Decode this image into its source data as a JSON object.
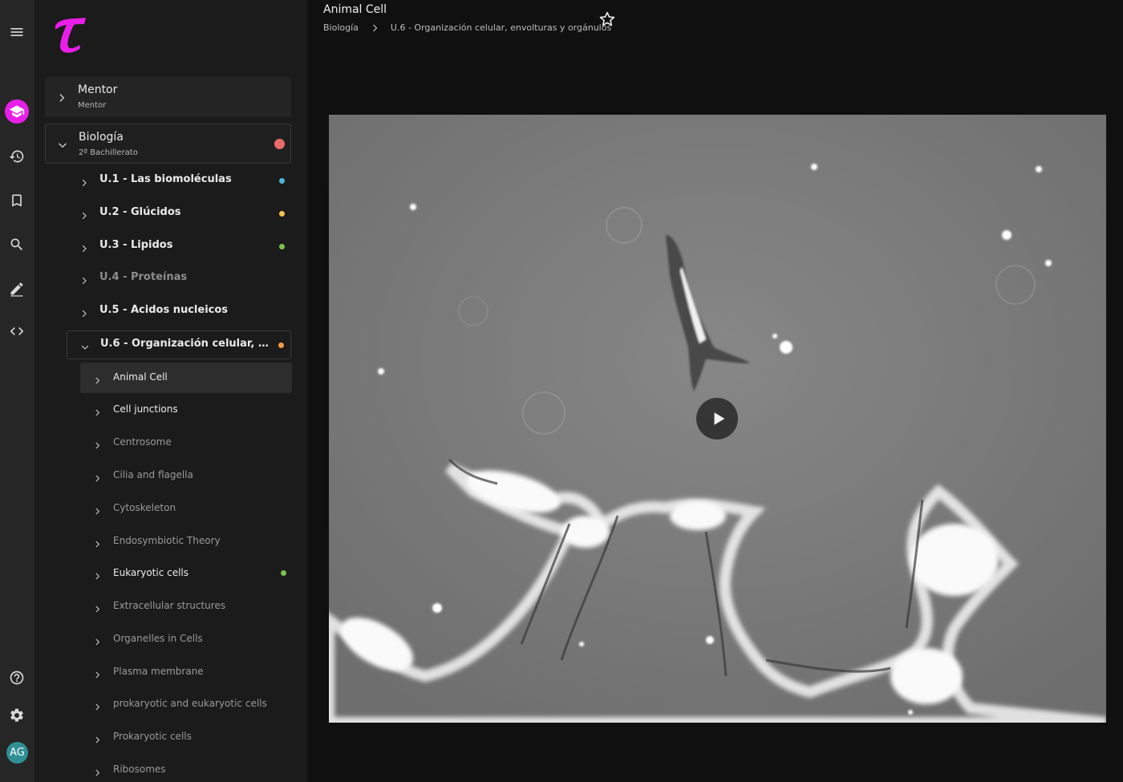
{
  "app": {
    "brand_color": "#e91ee8"
  },
  "rail": {
    "items": [
      {
        "name": "menu-icon"
      },
      {
        "name": "courses-icon"
      },
      {
        "name": "history-icon"
      },
      {
        "name": "bookmark-icon"
      },
      {
        "name": "search-icon"
      },
      {
        "name": "edit-icon"
      },
      {
        "name": "code-icon"
      },
      {
        "name": "help-icon"
      },
      {
        "name": "gear-icon"
      }
    ],
    "avatar_initials": "AG"
  },
  "sidebar": {
    "courses": [
      {
        "title": "Mentor",
        "subtitle": "Mentor"
      },
      {
        "title": "Biología",
        "subtitle": "2º Bachillerato",
        "status_color": "#e86a6a"
      }
    ],
    "units": [
      {
        "label": "U.1 - Las biomoléculas",
        "dot": "#4fb3d9"
      },
      {
        "label": "U.2 - Glúcidos",
        "dot": "#f2c14e"
      },
      {
        "label": "U.3 - Lipidos",
        "dot": "#7cc24b"
      },
      {
        "label": "U.4 - Proteínas",
        "dot": ""
      },
      {
        "label": "U.5 - Ácidos nucleicos",
        "dot": ""
      },
      {
        "label": "U.6 - Organización celular, envolturas y orgánulos",
        "dot": "#f29a4a"
      }
    ],
    "topics": [
      {
        "label": "Animal Cell",
        "selected": true,
        "bright": true
      },
      {
        "label": "Cell junctions",
        "bright": true
      },
      {
        "label": "Centrosome"
      },
      {
        "label": "Cilia and flagella"
      },
      {
        "label": "Cytoskeleton"
      },
      {
        "label": "Endosymbiotic Theory"
      },
      {
        "label": "Eukaryotic cells",
        "bright": true,
        "dot": "#7cc24b"
      },
      {
        "label": "Extracellular structures"
      },
      {
        "label": "Organelles in Cells"
      },
      {
        "label": "Plasma membrane"
      },
      {
        "label": "prokaryotic and eukaryotic cells"
      },
      {
        "label": "Prokaryotic cells"
      },
      {
        "label": "Ribosomes"
      }
    ]
  },
  "main": {
    "title": "Animal Cell",
    "breadcrumb": [
      "Biología",
      "U.6 - Organización celular, envolturas y orgánulos"
    ]
  }
}
